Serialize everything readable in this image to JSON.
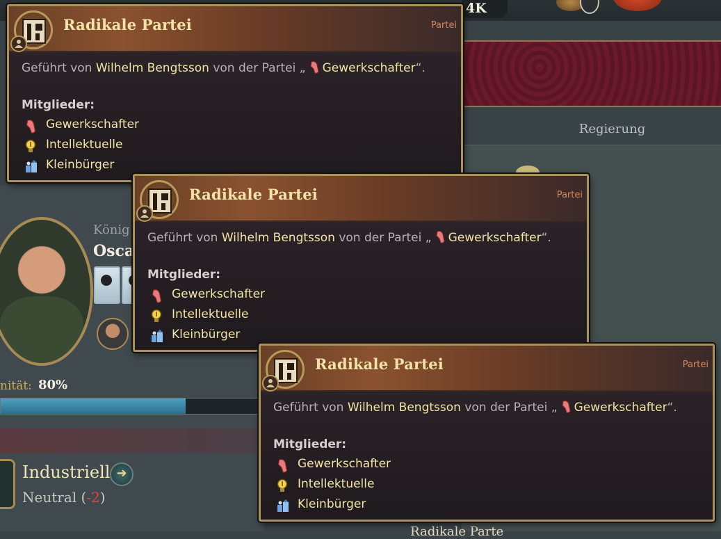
{
  "background": {
    "top_counter": "4K",
    "right_tab": "Regierung",
    "ruler_title": "König",
    "ruler_name": "Oscar",
    "legitimacy_label": "nität:",
    "legitimacy_value": "80%",
    "legitimacy_progress": 0.8,
    "interest_group": {
      "name": "Industrielle",
      "status_label": "Neutral (",
      "status_value": "-2",
      "status_close": ")"
    },
    "bottom_partial_title": "Radikale Parte"
  },
  "tooltips": [
    {
      "title": "Radikale Partei",
      "category": "Partei",
      "led_prefix": "Geführt von",
      "leader": "Wilhelm Bengtsson",
      "led_mid": "von der Partei „",
      "leader_group": "Gewerkschafter",
      "led_suffix": "“.",
      "members_label": "Mitglieder:",
      "members": [
        {
          "name": "Gewerkschafter",
          "icon": "trade-unions-icon"
        },
        {
          "name": "Intellektuelle",
          "icon": "lightbulb-icon"
        },
        {
          "name": "Kleinbürger",
          "icon": "petite-bourgeoisie-icon"
        }
      ]
    },
    {
      "title": "Radikale Partei",
      "category": "Partei",
      "led_prefix": "Geführt von",
      "leader": "Wilhelm Bengtsson",
      "led_mid": "von der Partei „",
      "leader_group": "Gewerkschafter",
      "led_suffix": "“.",
      "members_label": "Mitglieder:",
      "members": [
        {
          "name": "Gewerkschafter",
          "icon": "trade-unions-icon"
        },
        {
          "name": "Intellektuelle",
          "icon": "lightbulb-icon"
        },
        {
          "name": "Kleinbürger",
          "icon": "petite-bourgeoisie-icon"
        }
      ]
    },
    {
      "title": "Radikale Partei",
      "category": "Partei",
      "led_prefix": "Geführt von",
      "leader": "Wilhelm Bengtsson",
      "led_mid": "von der Partei „",
      "leader_group": "Gewerkschafter",
      "led_suffix": "“.",
      "members_label": "Mitglieder:",
      "members": [
        {
          "name": "Gewerkschafter",
          "icon": "trade-unions-icon"
        },
        {
          "name": "Intellektuelle",
          "icon": "lightbulb-icon"
        },
        {
          "name": "Kleinbürger",
          "icon": "petite-bourgeoisie-icon"
        }
      ]
    }
  ]
}
